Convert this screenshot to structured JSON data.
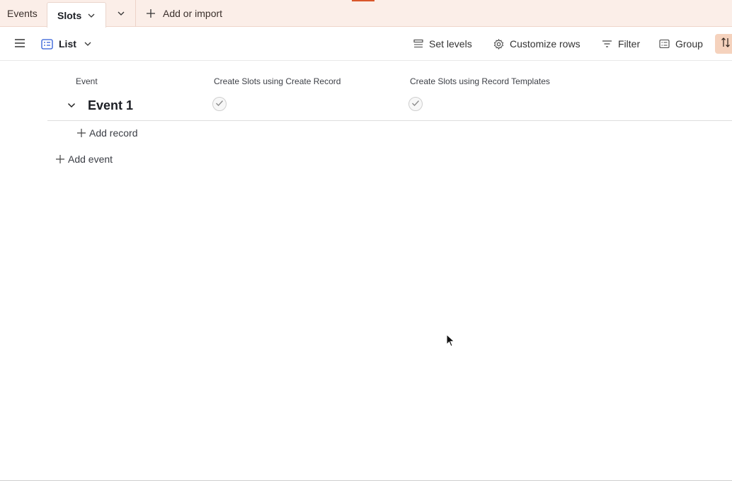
{
  "tabs": {
    "events_label": "Events",
    "slots_label": "Slots",
    "add_label": "Add or import"
  },
  "toolbar": {
    "view_label": "List",
    "set_levels_label": "Set levels",
    "customize_rows_label": "Customize rows",
    "filter_label": "Filter",
    "group_label": "Group"
  },
  "list": {
    "columns": [
      "Event",
      "Create Slots using Create Record",
      "Create Slots using Record Templates"
    ],
    "group_title": "Event 1",
    "add_record_label": "Add record",
    "add_event_label": "Add event"
  },
  "colors": {
    "tabbar_bg": "#fbeee8",
    "accent": "#d9572b",
    "sort_bg": "#f5d2bd"
  }
}
